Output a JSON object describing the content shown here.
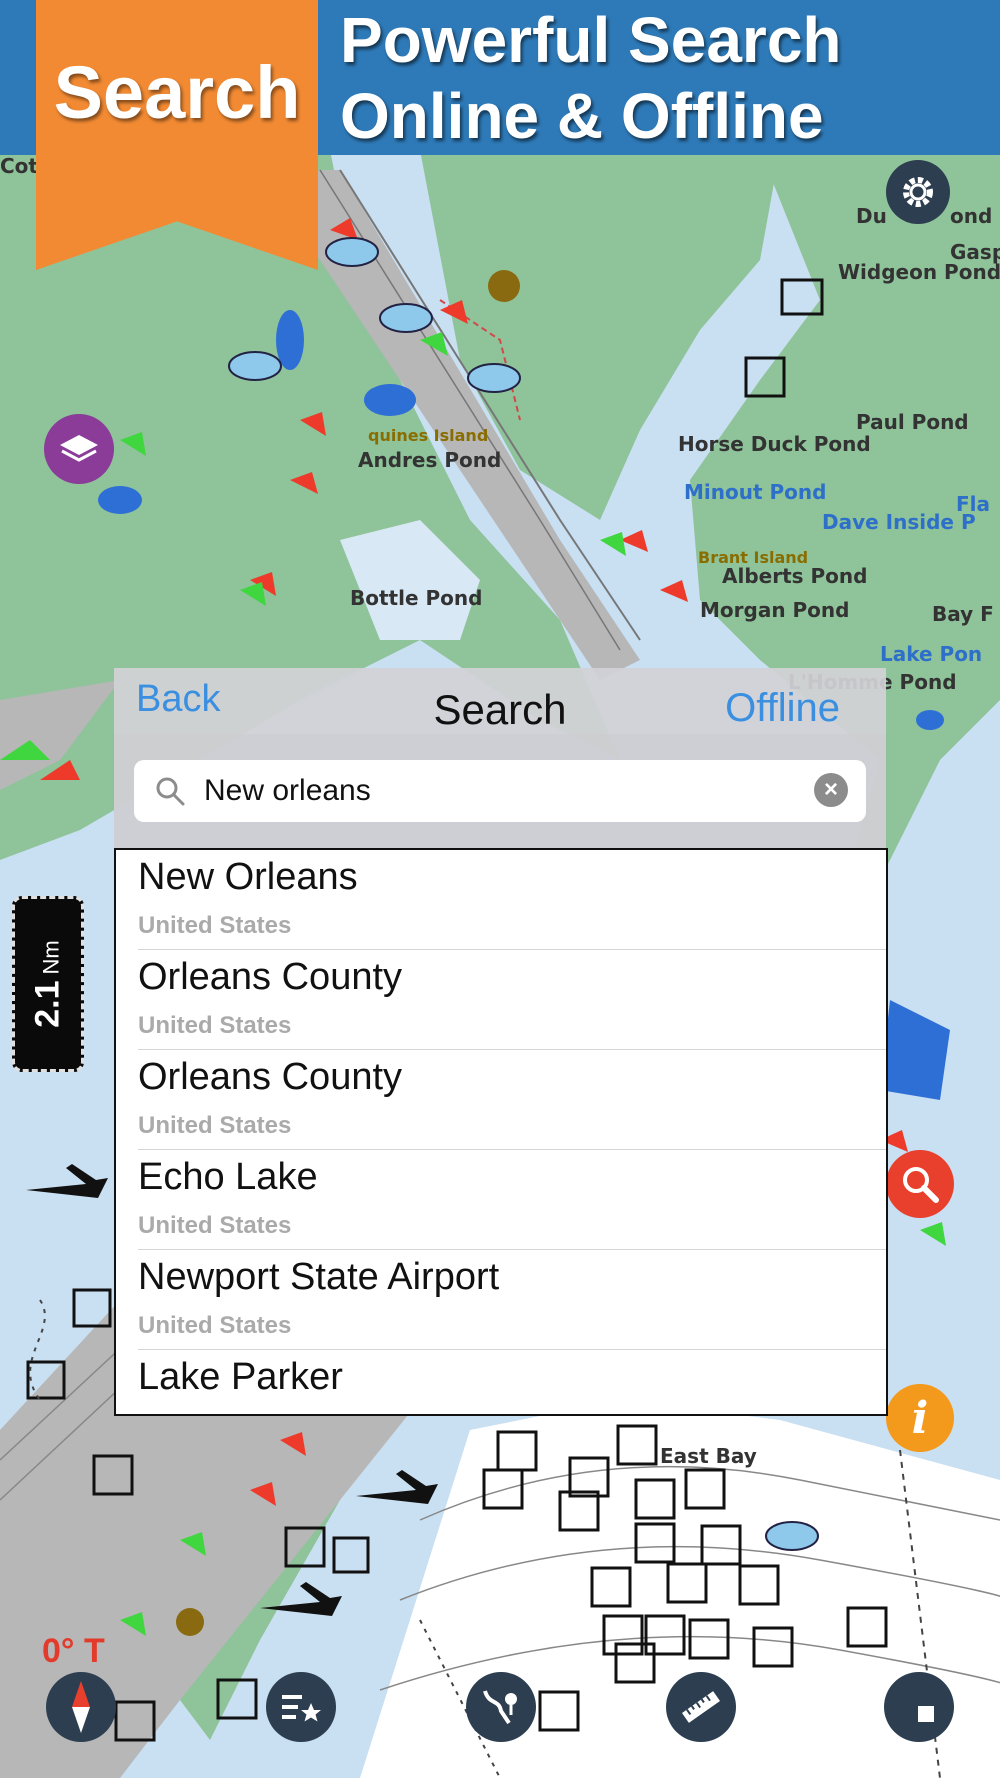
{
  "banner": {
    "line1": "Powerful Search",
    "line2": "Online & Offline",
    "tag": "Search"
  },
  "map_labels": {
    "andres_pond": "Andres Pond",
    "bottle_pond": "Bottle Pond",
    "paul_pond": "Paul Pond",
    "horse_duck_pond": "Horse Duck Pond",
    "minout_pond": "Minout Pond",
    "dave_inside": "Dave Inside P",
    "brant_island": "Brant Island",
    "alberts_pond": "Alberts Pond",
    "morgan_pond": "Morgan Pond",
    "bay": "Bay F",
    "lake_pond": "Lake Pon",
    "lhomme_pond": "L'Homme Pond",
    "widgeon": "Widgeon Pond",
    "gasp": "Gasp",
    "du": "Du",
    "ond": "ond",
    "cott": "Cott",
    "quines_island": "quines Island",
    "east_bay": "East Bay",
    "fla": "Fla"
  },
  "search_panel": {
    "back_label": "Back",
    "title": "Search",
    "offline_label": "Offline",
    "query": "New orleans",
    "results": [
      {
        "name": "New Orleans",
        "country": "United States"
      },
      {
        "name": "Orleans County",
        "country": "United States"
      },
      {
        "name": "Orleans County",
        "country": "United States"
      },
      {
        "name": "Echo Lake",
        "country": "United States"
      },
      {
        "name": "Newport State Airport",
        "country": "United States"
      },
      {
        "name": "Lake Parker",
        "country": ""
      }
    ]
  },
  "scale": {
    "value": "2.1",
    "unit": "Nm"
  },
  "heading": "0° T",
  "icons": {
    "settings": "gear-icon",
    "layers": "layers-icon",
    "search": "magnifier-icon",
    "info": "info-icon",
    "compass": "compass-icon",
    "favorites": "favorites-list-icon",
    "route": "route-icon",
    "measure": "ruler-icon",
    "record": "stop-icon"
  },
  "colors": {
    "banner_blue": "#2e7ab8",
    "tag_orange": "#f28a33",
    "link_blue": "#3a8fe0",
    "land_green": "#8fc39a",
    "water_blue": "#c9dff2"
  }
}
